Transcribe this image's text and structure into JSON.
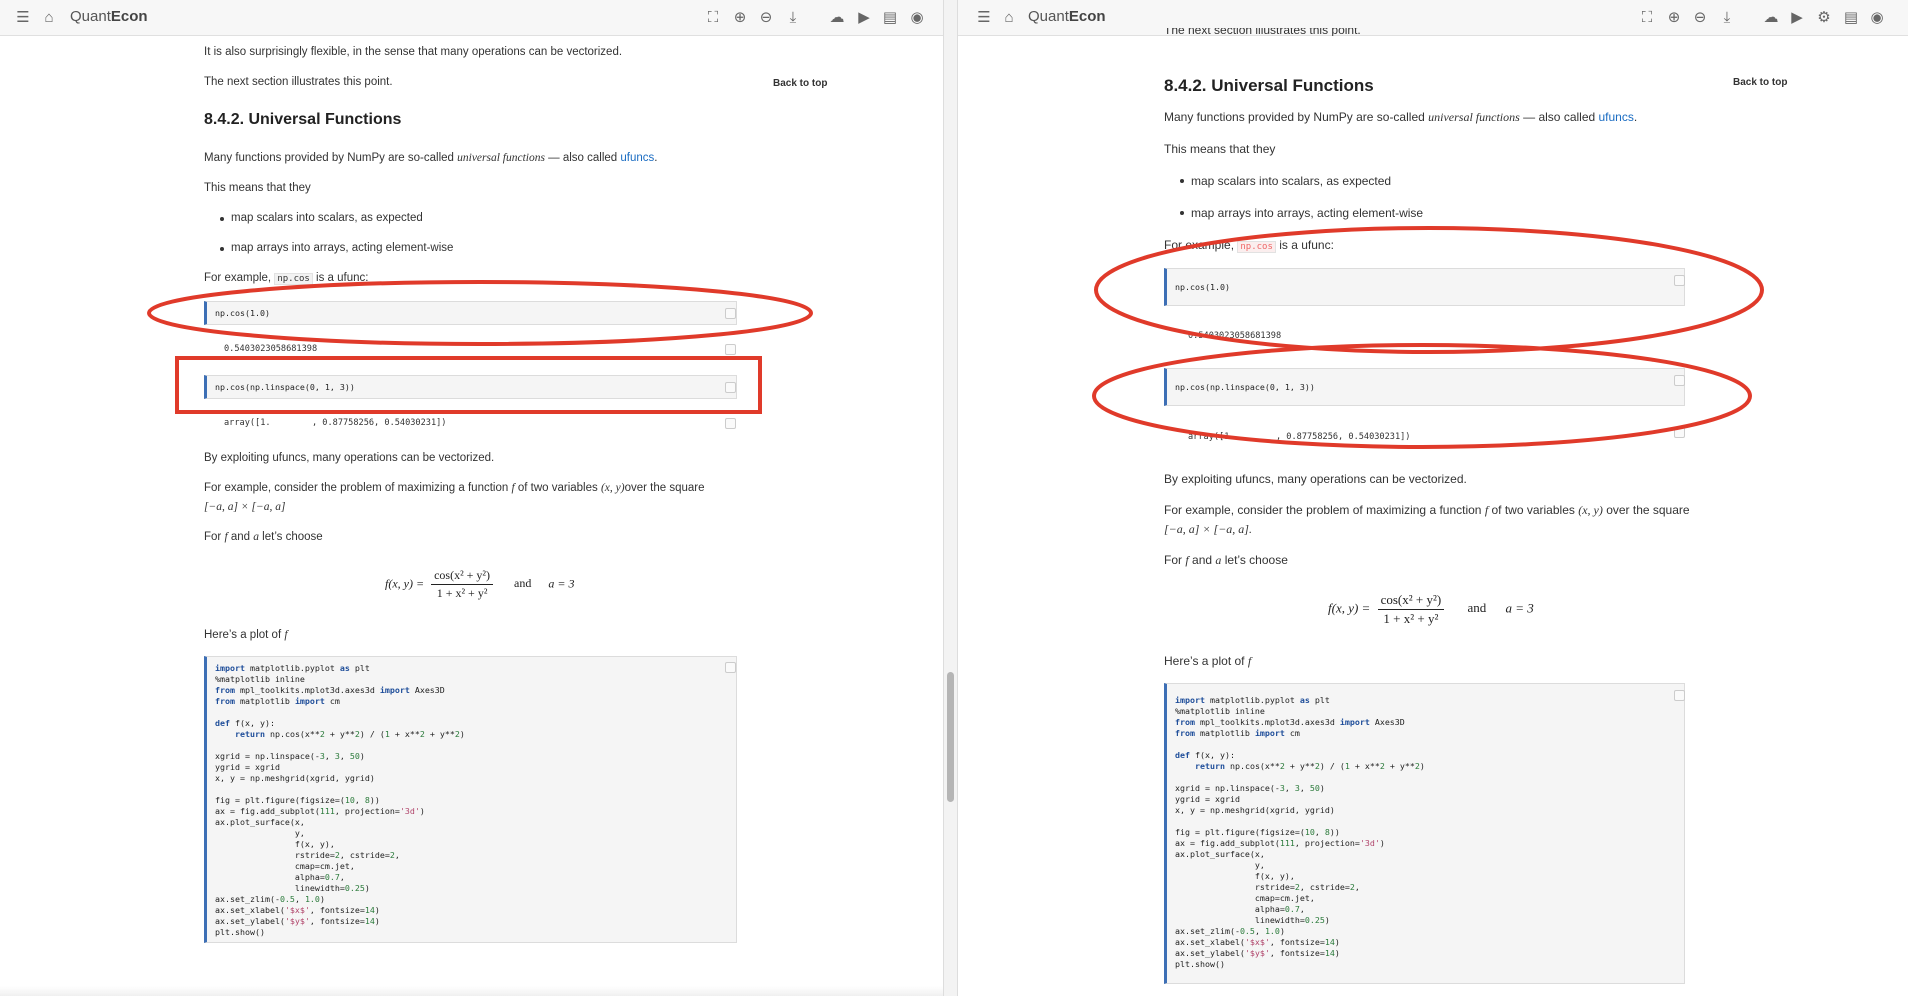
{
  "app": {
    "brand_prefix": "Quant",
    "brand_suffix": "Econ"
  },
  "colors": {
    "annotation": "#e03a2a",
    "link": "#1a6cc2",
    "code_border": "#3d6fb5"
  },
  "icons": {
    "left_toolbar": [
      "menu-icon",
      "home-icon"
    ],
    "right_toolbar": [
      "fullscreen-icon",
      "zoom-in-icon",
      "zoom-out-icon",
      "download-icon",
      "cloud-upload-icon",
      "play-icon",
      "settings-icon",
      "pdf-icon",
      "github-icon"
    ]
  },
  "doc": {
    "intro_flexible": "It is also surprisingly flexible, in the sense that many operations can be vectorized.",
    "intro_next": "The next section illustrates this point.",
    "intro_next_cut": "The next section illustrates this point.",
    "heading": "8.4.2. Universal Functions",
    "back_to_top": "Back to top",
    "ufunc_pre": "Many functions provided by NumPy are so-called ",
    "ufunc_em": "universal functions",
    "ufunc_mid": " — also called ",
    "ufunc_link": "ufuncs",
    "ufunc_end": ".",
    "means": "This means that they",
    "bullet1": "map scalars into scalars, as expected",
    "bullet2": "map arrays into arrays, acting element-wise",
    "example_pre": "For example, ",
    "example_code": "np.cos",
    "example_post": " is a ufunc:",
    "code1": "np.cos(1.0)",
    "out1": "0.5403023058681398",
    "code2": "np.cos(np.linspace(0, 1, 3))",
    "out2": "array([1.        , 0.87758256, 0.54030231])",
    "exploit": "By exploiting ufuncs, many operations can be vectorized.",
    "consider_pre": "For example, consider the problem of maximizing a function ",
    "consider_f": "f",
    "consider_mid": " of two variables ",
    "consider_xy": "(x, y)",
    "consider_post": "over the square",
    "consider_post_right": " over the square",
    "square": "[−a, a] × [−a, a]",
    "square_right": "[−a, a] × [−a, a].",
    "choose_pre": "For ",
    "choose_f": "f",
    "choose_mid": " and ",
    "choose_a": "a",
    "choose_post": " let’s choose",
    "eq_lhs": "f(x, y) =",
    "eq_num": "cos(x² + y²)",
    "eq_den": "1 + x² + y²",
    "eq_and": "and",
    "eq_a": "a = 3",
    "plot_pre": "Here’s a plot of ",
    "plot_f": "f",
    "code3": [
      "import matplotlib.pyplot as plt",
      "%matplotlib inline",
      "from mpl_toolkits.mplot3d.axes3d import Axes3D",
      "from matplotlib import cm",
      "",
      "def f(x, y):",
      "    return np.cos(x**2 + y**2) / (1 + x**2 + y**2)",
      "",
      "xgrid = np.linspace(-3, 3, 50)",
      "ygrid = xgrid",
      "x, y = np.meshgrid(xgrid, ygrid)",
      "",
      "fig = plt.figure(figsize=(10, 8))",
      "ax = fig.add_subplot(111, projection='3d')",
      "ax.plot_surface(x,",
      "                y,",
      "                f(x, y),",
      "                rstride=2, cstride=2,",
      "                cmap=cm.jet,",
      "                alpha=0.7,",
      "                linewidth=0.25)",
      "ax.set_zlim(-0.5, 1.0)",
      "ax.set_xlabel('$x$', fontsize=14)",
      "ax.set_ylabel('$y$', fontsize=14)",
      "plt.show()"
    ]
  }
}
